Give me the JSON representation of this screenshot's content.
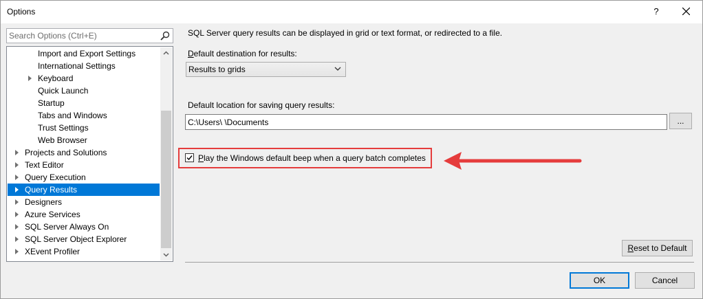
{
  "window": {
    "title": "Options",
    "help_label": "?"
  },
  "search": {
    "placeholder": "Search Options (Ctrl+E)",
    "value": ""
  },
  "tree": {
    "items": [
      {
        "label": "Import and Export Settings",
        "expandable": false,
        "selected": false
      },
      {
        "label": "International Settings",
        "expandable": false,
        "selected": false
      },
      {
        "label": "Keyboard",
        "expandable": true,
        "selected": false
      },
      {
        "label": "Quick Launch",
        "expandable": false,
        "selected": false
      },
      {
        "label": "Startup",
        "expandable": false,
        "selected": false
      },
      {
        "label": "Tabs and Windows",
        "expandable": false,
        "selected": false
      },
      {
        "label": "Trust Settings",
        "expandable": false,
        "selected": false
      },
      {
        "label": "Web Browser",
        "expandable": false,
        "selected": false
      },
      {
        "label": "Projects and Solutions",
        "expandable": true,
        "selected": false
      },
      {
        "label": "Text Editor",
        "expandable": true,
        "selected": false
      },
      {
        "label": "Query Execution",
        "expandable": true,
        "selected": false
      },
      {
        "label": "Query Results",
        "expandable": true,
        "selected": true
      },
      {
        "label": "Designers",
        "expandable": true,
        "selected": false
      },
      {
        "label": "Azure Services",
        "expandable": true,
        "selected": false
      },
      {
        "label": "SQL Server Always On",
        "expandable": true,
        "selected": false
      },
      {
        "label": "SQL Server Object Explorer",
        "expandable": true,
        "selected": false
      },
      {
        "label": "XEvent Profiler",
        "expandable": true,
        "selected": false
      }
    ]
  },
  "panel": {
    "description": "SQL Server query results can be displayed in grid or text format, or redirected to a file.",
    "destination_label_accel": "D",
    "destination_label_rest": "efault destination for results:",
    "destination_value": "Results to grids",
    "location_label": "Default location for saving query results:",
    "location_value": "C:\\Users\\              \\Documents",
    "browse_label": "...",
    "beep_checked": true,
    "beep_label_accel": "P",
    "beep_label_rest": "lay the Windows default beep when a query batch completes",
    "reset_accel": "R",
    "reset_rest": "eset to Default"
  },
  "footer": {
    "ok_label": "OK",
    "cancel_label": "Cancel"
  },
  "colors": {
    "selection": "#0078d7",
    "annotation": "#e53c3c"
  },
  "icons": {
    "search": "magnifier-icon",
    "close": "close-icon",
    "dropdown": "chevron-down-icon",
    "expander": "triangle-right-icon",
    "annotation": "arrow-left-icon"
  }
}
